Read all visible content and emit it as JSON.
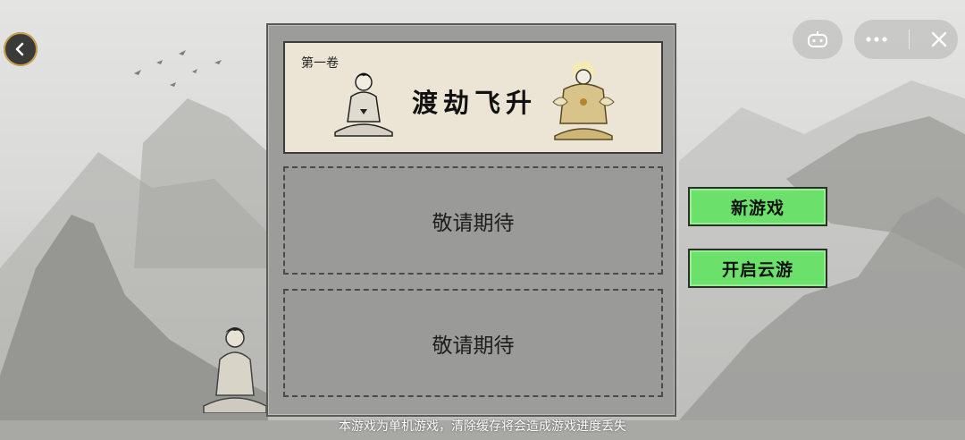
{
  "chapter": {
    "volume": "第一卷",
    "title": "渡劫飞升"
  },
  "slots": [
    {
      "label": "敬请期待"
    },
    {
      "label": "敬请期待"
    }
  ],
  "buttons": {
    "new_game": "新游戏",
    "cloud_play": "开启云游"
  },
  "footer": {
    "notice": "本游戏为单机游戏，清除缓存将会造成游戏进度丢失"
  },
  "icons": {
    "back": "back-arrow-icon",
    "gamepad": "gamepad-icon",
    "more": "more-dots-icon",
    "close": "close-icon"
  },
  "colors": {
    "button_green": "#6be06a",
    "panel_gray": "#9c9c9a",
    "chapter_paper": "#ece5d6"
  }
}
